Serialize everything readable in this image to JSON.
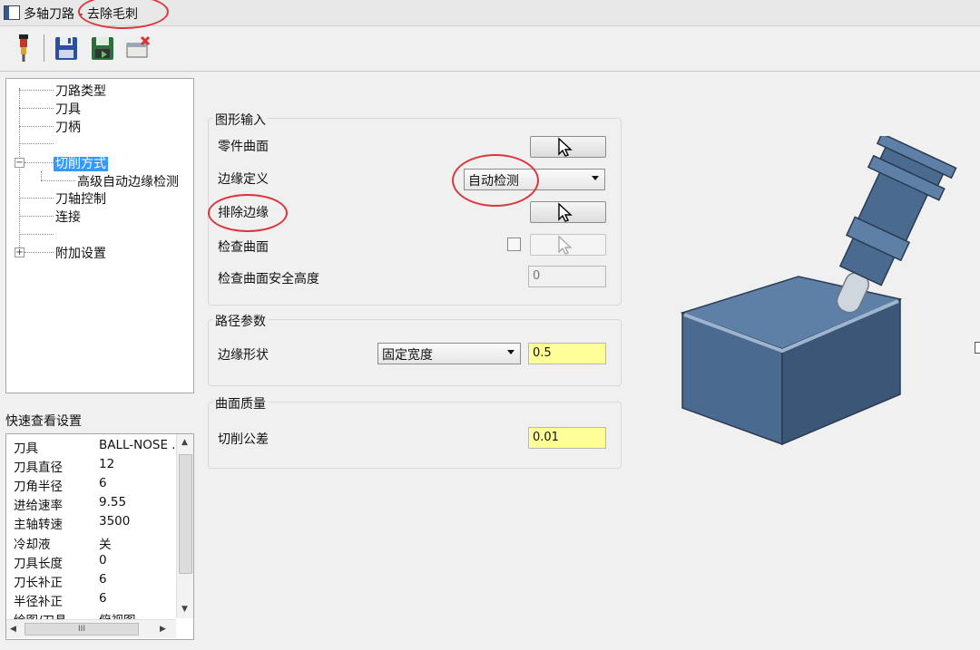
{
  "window": {
    "title_prefix": "多轴刀路",
    "title_suffix": " - 去除毛刺"
  },
  "toolbar": {
    "icons": [
      "tool-icon",
      "save-icon",
      "save-as-icon",
      "delete-icon"
    ]
  },
  "tree": {
    "items": [
      {
        "label": "刀路类型"
      },
      {
        "label": "刀具"
      },
      {
        "label": "刀柄"
      },
      {
        "label": ""
      },
      {
        "label": "切削方式"
      },
      {
        "label": "高级自动边缘检测"
      },
      {
        "label": "刀轴控制"
      },
      {
        "label": "连接"
      },
      {
        "label": ""
      },
      {
        "label": "附加设置"
      }
    ],
    "selected": "切削方式"
  },
  "quickview": {
    "title": "快速查看设置",
    "rows": [
      {
        "key": "刀具",
        "value": "BALL-NOSE ."
      },
      {
        "key": "刀具直径",
        "value": "12"
      },
      {
        "key": "刀角半径",
        "value": "6"
      },
      {
        "key": "进给速率",
        "value": "9.55"
      },
      {
        "key": "主轴转速",
        "value": "3500"
      },
      {
        "key": "冷却液",
        "value": "关"
      },
      {
        "key": "刀具长度",
        "value": "0"
      },
      {
        "key": "刀长补正",
        "value": "6"
      },
      {
        "key": "半径补正",
        "value": "6"
      },
      {
        "key": "绘图/刀具",
        "value": "俯视图"
      }
    ],
    "hscroll_thumb": "III"
  },
  "geometry_input": {
    "title": "图形输入",
    "part_surface": "零件曲面",
    "edge_definition": "边缘定义",
    "edge_definition_value": "自动检测",
    "exclude_edges": "排除边缘",
    "check_surface": "检查曲面",
    "check_surface_clearance": "检查曲面安全高度",
    "check_surface_clearance_value": "0"
  },
  "path_params": {
    "title": "路径参数",
    "edge_shape": "边缘形状",
    "edge_shape_value": "固定宽度",
    "edge_shape_width": "0.5"
  },
  "surface_quality": {
    "title": "曲面质量",
    "cut_tolerance": "切削公差",
    "cut_tolerance_value": "0.01"
  },
  "colors": {
    "annotation_red": "#d9373b",
    "selection_blue": "#3399ff",
    "highlight_field": "#ffff99",
    "block_front": "#4a6a90",
    "block_side": "#3c5678",
    "block_top": "#5e7fa6"
  }
}
